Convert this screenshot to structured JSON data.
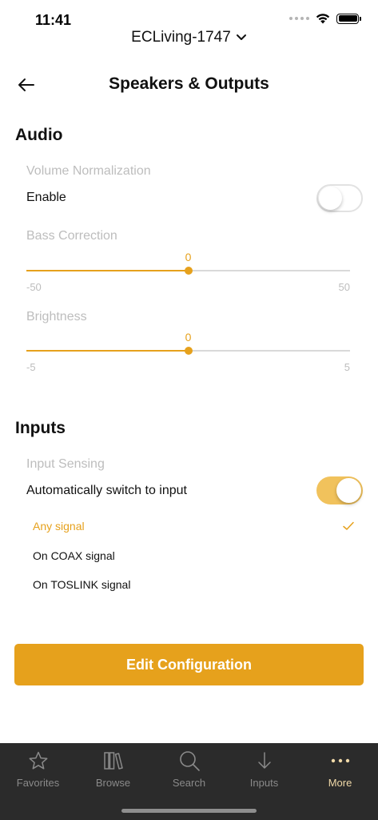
{
  "status_bar": {
    "time": "11:41"
  },
  "device_selector": {
    "name": "ECLiving-1747"
  },
  "header": {
    "title": "Speakers & Outputs"
  },
  "audio": {
    "section_title": "Audio",
    "volume_normalization": {
      "group_label": "Volume Normalization",
      "enable_label": "Enable",
      "enabled": false
    },
    "bass_correction": {
      "group_label": "Bass Correction",
      "value": "0",
      "min": "-50",
      "max": "50"
    },
    "brightness": {
      "group_label": "Brightness",
      "value": "0",
      "min": "-5",
      "max": "5"
    }
  },
  "inputs": {
    "section_title": "Inputs",
    "input_sensing": {
      "group_label": "Input Sensing",
      "auto_switch_label": "Automatically switch to input",
      "enabled": true
    },
    "options": [
      {
        "label": "Any signal",
        "selected": true
      },
      {
        "label": "On COAX signal",
        "selected": false
      },
      {
        "label": "On TOSLINK signal",
        "selected": false
      }
    ]
  },
  "actions": {
    "edit_configuration_label": "Edit Configuration"
  },
  "tab_bar": {
    "tabs": [
      {
        "label": "Favorites",
        "icon": "star-icon",
        "active": false
      },
      {
        "label": "Browse",
        "icon": "library-icon",
        "active": false
      },
      {
        "label": "Search",
        "icon": "search-icon",
        "active": false
      },
      {
        "label": "Inputs",
        "icon": "arrow-down-icon",
        "active": false
      },
      {
        "label": "More",
        "icon": "more-dots-icon",
        "active": true
      }
    ]
  },
  "colors": {
    "accent": "#e6a11c",
    "toggle_on": "#f1c25c",
    "tab_bar_bg": "#2b2b2b",
    "muted_text": "#bdbdbd"
  }
}
